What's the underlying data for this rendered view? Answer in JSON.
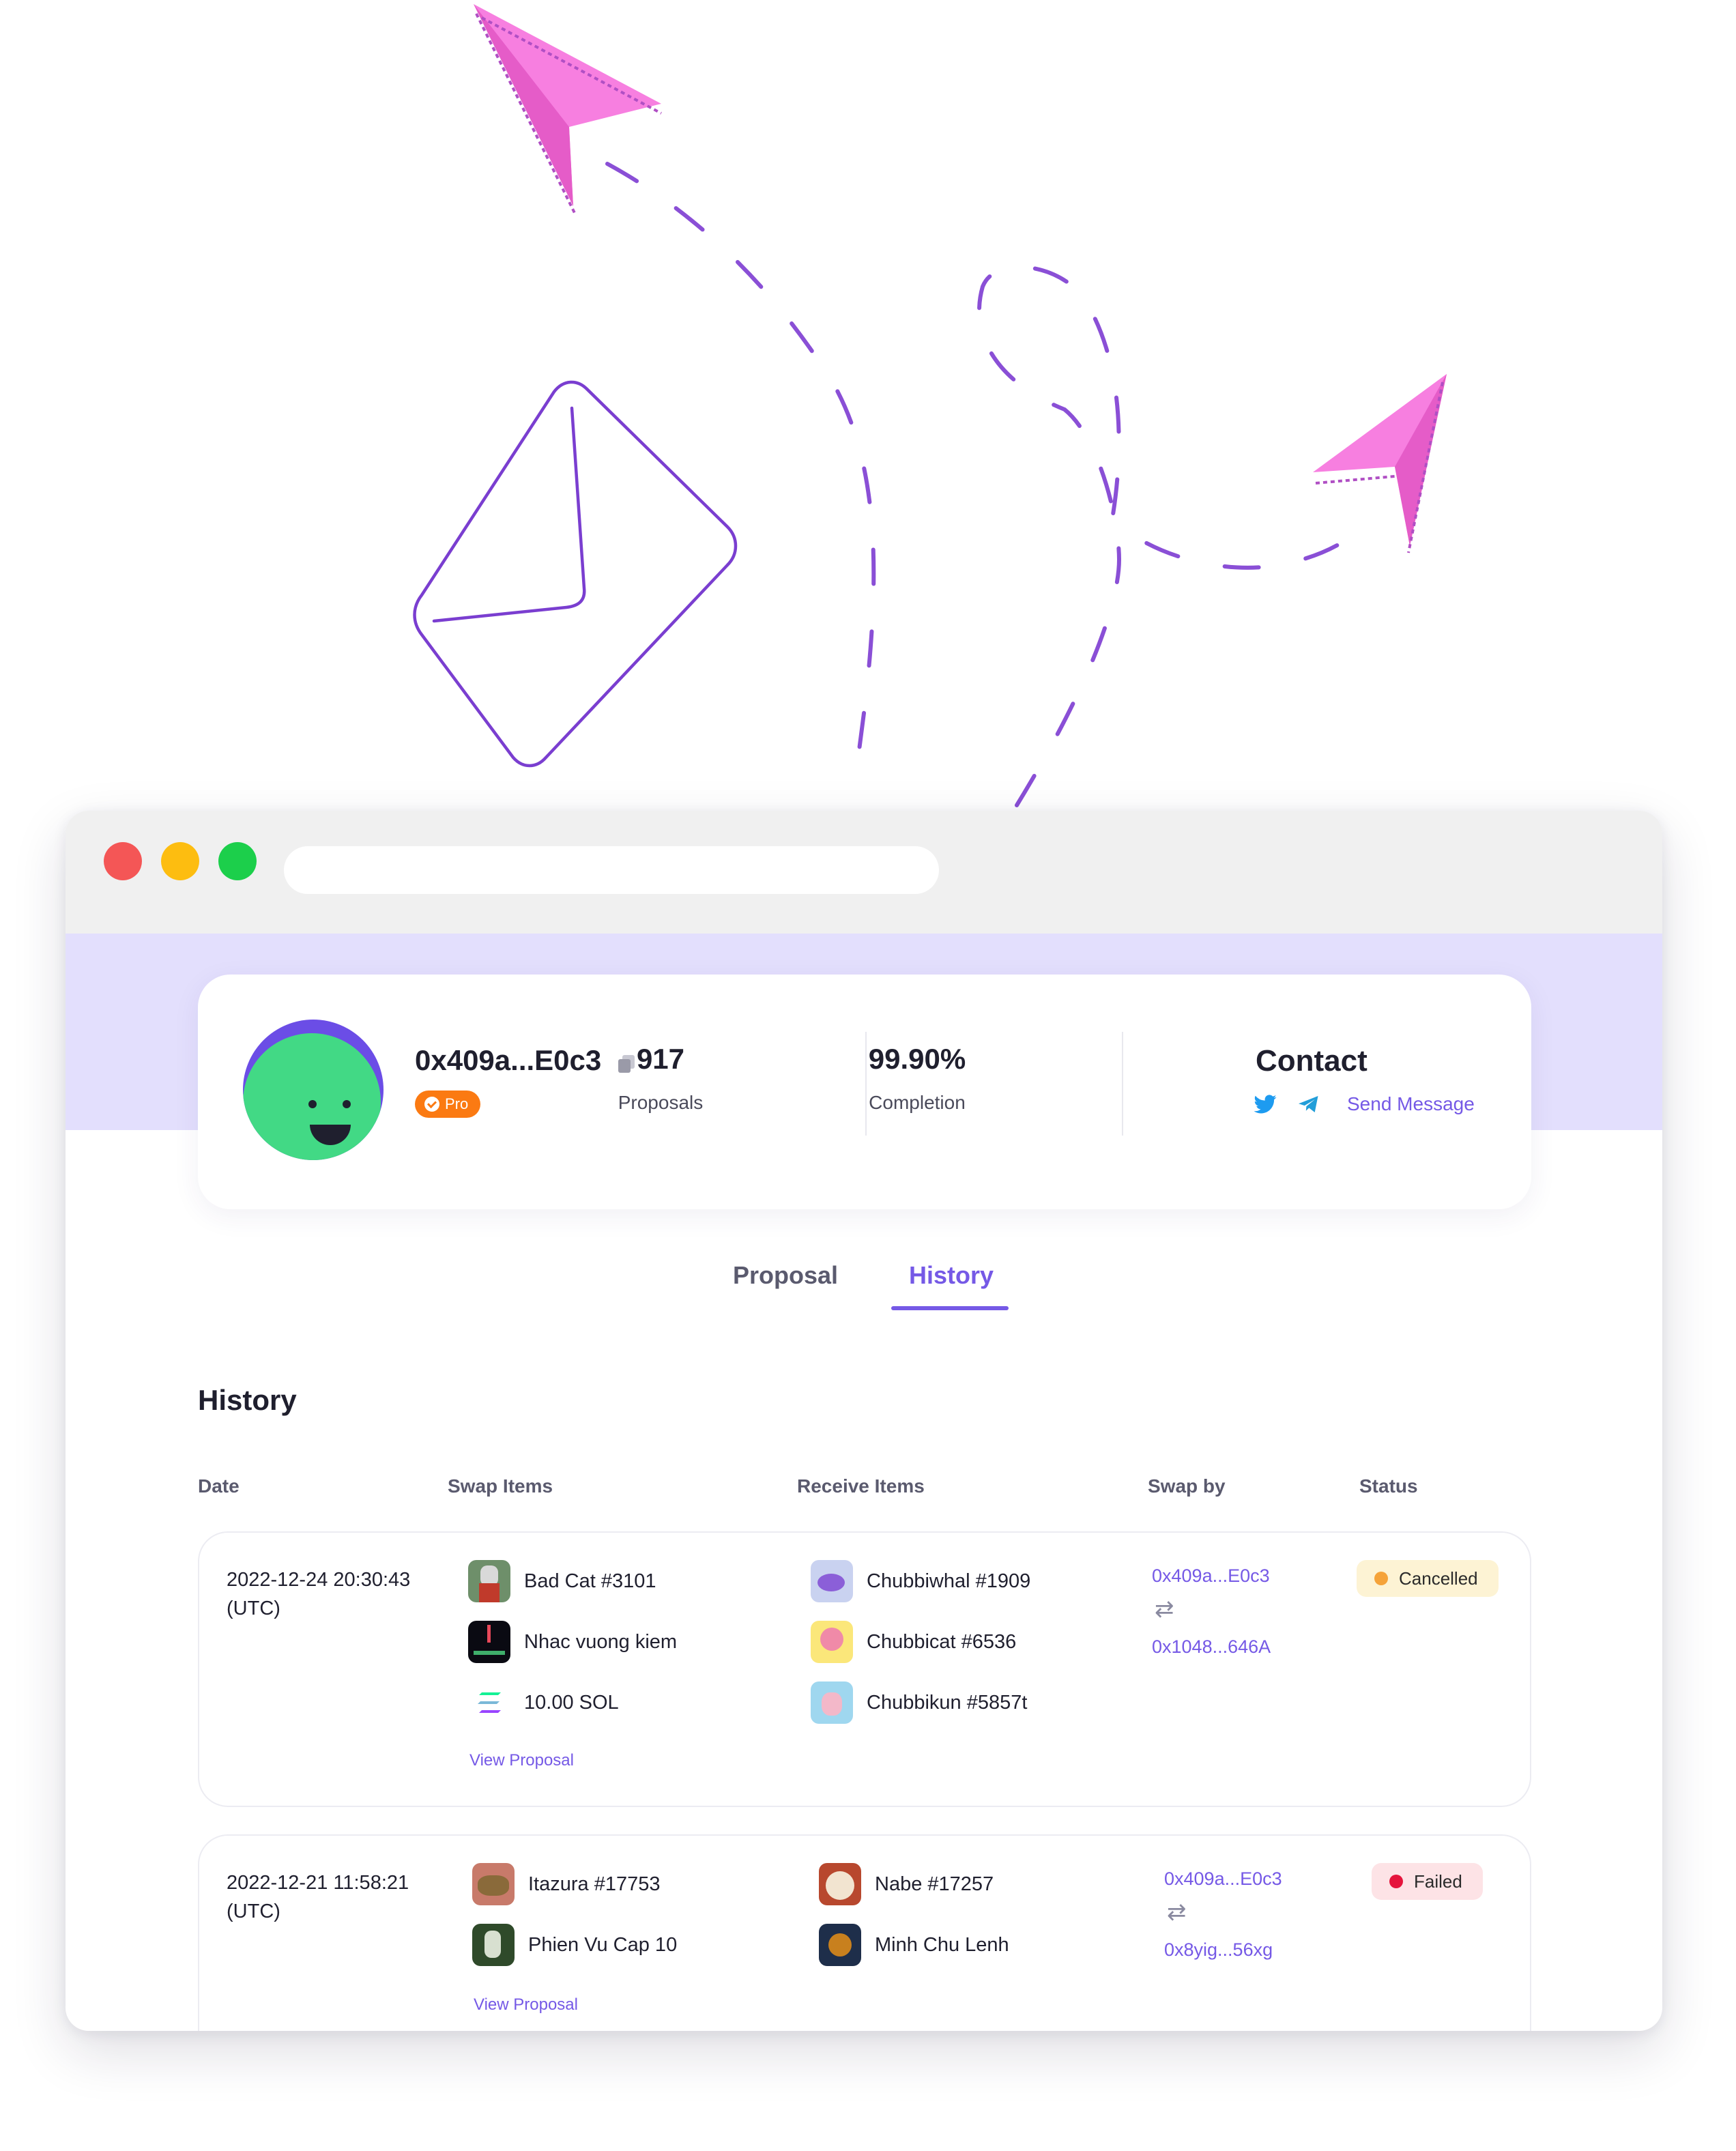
{
  "profile": {
    "address": "0x409a...E0c3",
    "badge": "Pro",
    "stats": [
      {
        "value": "917",
        "label": "Proposals"
      },
      {
        "value": "99.90%",
        "label": "Completion"
      }
    ],
    "contact": {
      "title": "Contact",
      "send_label": "Send Message"
    }
  },
  "tabs": [
    {
      "label": "Proposal",
      "active": false
    },
    {
      "label": "History",
      "active": true
    }
  ],
  "history": {
    "title": "History",
    "columns": [
      "Date",
      "Swap Items",
      "Receive Items",
      "Swap by",
      "Status"
    ],
    "rows": [
      {
        "date": "2022-12-24 20:30:43",
        "tz": "(UTC)",
        "swap_items": [
          "Bad Cat #3101",
          "Nhac vuong kiem",
          "10.00 SOL"
        ],
        "receive_items": [
          "Chubbiwhal #1909",
          "Chubbicat #6536",
          "Chubbikun #5857t"
        ],
        "swap_from": "0x409a...E0c3",
        "swap_to": "0x1048...646A",
        "view": "View Proposal",
        "status": "Cancelled"
      },
      {
        "date": "2022-12-21 11:58:21",
        "tz": "(UTC)",
        "swap_items": [
          "Itazura #17753",
          "Phien Vu Cap 10"
        ],
        "receive_items": [
          "Nabe #17257",
          "Minh Chu Lenh"
        ],
        "swap_from": "0x409a...E0c3",
        "swap_to": "0x8yig...56xg",
        "view": "View Proposal",
        "status": "Failed"
      }
    ]
  },
  "colors": {
    "accent": "#7559e6",
    "hero": "#e3dffd",
    "pro": "#fb7a12",
    "cancelled": "#f5a33a",
    "failed": "#e5143c",
    "plane": "#f77fe0"
  },
  "icons": [
    "paper-plane-icon",
    "envelope-icon",
    "copy-icon",
    "verified-check-icon",
    "twitter-icon",
    "telegram-icon",
    "swap-arrows-icon"
  ]
}
